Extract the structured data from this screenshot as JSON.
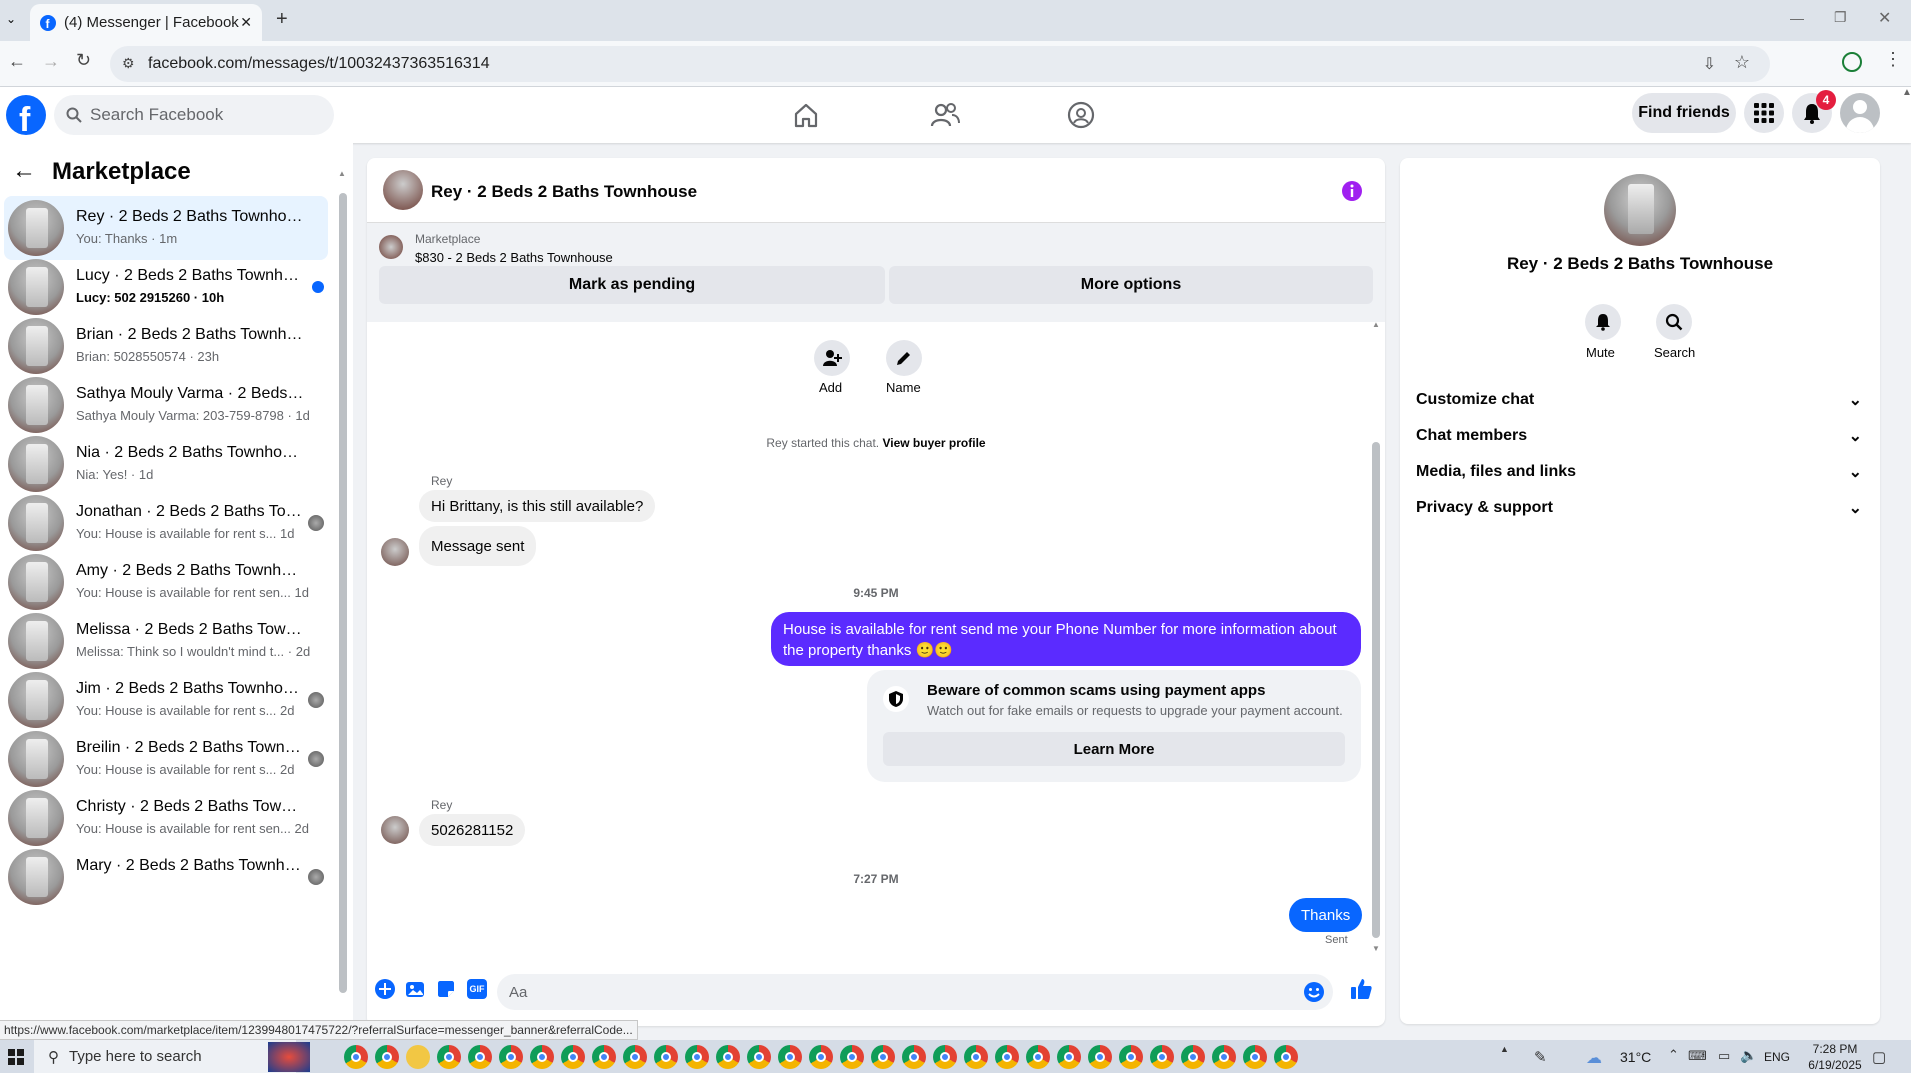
{
  "browser": {
    "tab_title": "(4) Messenger | Facebook",
    "url": "facebook.com/messages/t/10032437363516314",
    "status_url": "https://www.facebook.com/marketplace/item/1239948017475722/?referralSurface=messenger_banner&referralCode..."
  },
  "header": {
    "search_placeholder": "Search Facebook",
    "find_friends": "Find friends",
    "notif_count": "4"
  },
  "sidebar": {
    "title": "Marketplace",
    "conversations": [
      {
        "name": "Rey · 2 Beds 2 Baths Townhouse",
        "snippet": "You: Thanks · 1m",
        "active": true
      },
      {
        "name": "Lucy · 2 Beds 2 Baths Townhou...",
        "snippet": "Lucy: 502 2915260 · 10h",
        "unread": true
      },
      {
        "name": "Brian · 2 Beds 2 Baths Townhouse",
        "snippet": "Brian: 5028550574 · 23h"
      },
      {
        "name": "Sathya Mouly Varma · 2 Beds 2 ...",
        "snippet": "Sathya Mouly Varma: 203-759-8798 · 1d"
      },
      {
        "name": "Nia · 2 Beds 2 Baths Townhouse",
        "snippet": "Nia: Yes! · 1d"
      },
      {
        "name": "Jonathan · 2 Beds 2 Baths Tow...",
        "snippet": "You: House is available for rent s...   1d",
        "seen": true
      },
      {
        "name": "Amy · 2 Beds 2 Baths Townhouse",
        "snippet": "You: House is available for rent sen...   1d"
      },
      {
        "name": "Melissa · 2 Beds 2 Baths Townho...",
        "snippet": "Melissa: Think so I wouldn't mind t... · 2d"
      },
      {
        "name": "Jim · 2 Beds 2 Baths Townhouse",
        "snippet": "You: House is available for rent s...   2d",
        "seen": true
      },
      {
        "name": "Breilin · 2 Beds 2 Baths Townh...",
        "snippet": "You: House is available for rent s...   2d",
        "seen": true
      },
      {
        "name": "Christy · 2 Beds 2 Baths Townho...",
        "snippet": "You: House is available for rent sen...   2d"
      },
      {
        "name": "Mary · 2 Beds 2 Baths Townho...",
        "snippet": "",
        "seen": true
      }
    ]
  },
  "chat": {
    "title": "Rey · 2 Beds 2 Baths Townhouse",
    "listing_label": "Marketplace",
    "listing_detail": "$830 - 2 Beds 2 Baths Townhouse",
    "mark_pending": "Mark as pending",
    "more_options": "More options",
    "add_label": "Add",
    "name_label": "Name",
    "started_text": "Rey started this chat.",
    "view_profile": "View buyer profile",
    "sender1": "Rey",
    "msg1": "Hi Brittany, is this still available?",
    "msg2": "Message sent",
    "time1": "9:45 PM",
    "msg3_line1": "House is available for rent send me your Phone Number for more information about",
    "msg3_line2": "the property thanks 🙂🙂",
    "scam_title": "Beware of common scams using payment apps",
    "scam_sub": "Watch out for fake emails or requests to upgrade your payment account.",
    "learn_more": "Learn More",
    "sender2": "Rey",
    "msg4": "5026281152",
    "time2": "7:27 PM",
    "msg5": "Thanks",
    "sent": "Sent",
    "composer_placeholder": "Aa"
  },
  "info": {
    "name": "Rey · 2 Beds 2 Baths Townhouse",
    "mute": "Mute",
    "search": "Search",
    "sections": [
      "Customize chat",
      "Chat members",
      "Media, files and links",
      "Privacy & support"
    ]
  },
  "taskbar": {
    "search_placeholder": "Type here to search",
    "temp": "31°C",
    "lang": "ENG",
    "time": "7:28 PM",
    "date": "6/19/2025"
  },
  "colors": {
    "fb_blue": "#0866ff",
    "purple_bubble": "#5b2bff",
    "info_purple": "#a020f0",
    "badge_red": "#e41e3f"
  }
}
